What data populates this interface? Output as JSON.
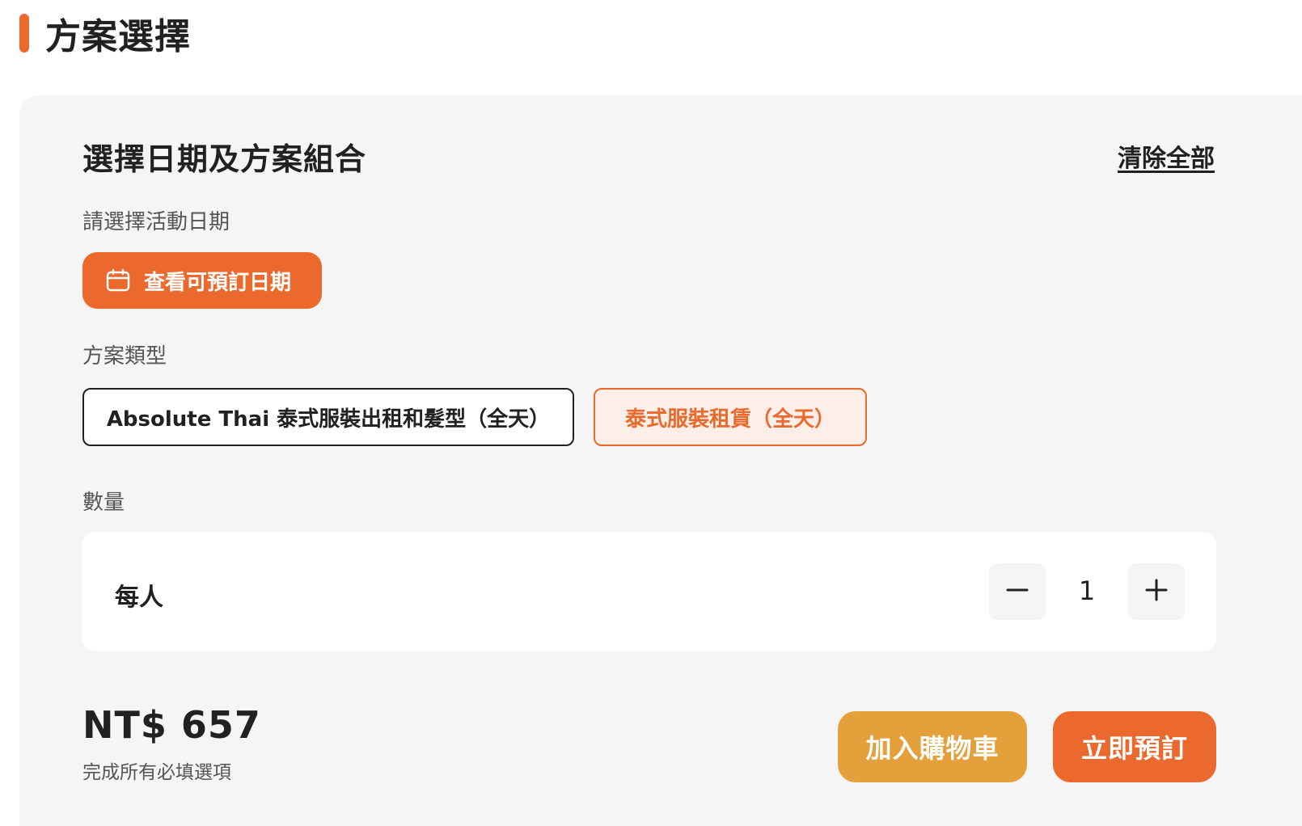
{
  "section": {
    "title": "方案選擇"
  },
  "panel": {
    "title": "選擇日期及方案組合",
    "clear_all": "清除全部"
  },
  "date": {
    "label": "請選擇活動日期",
    "button_label": "查看可預訂日期",
    "button_icon": "calendar-icon"
  },
  "package_type": {
    "label": "方案類型",
    "options": [
      {
        "label": "Absolute Thai 泰式服裝出租和髮型（全天）",
        "selected": false
      },
      {
        "label": "泰式服裝租賃（全天）",
        "selected": true
      }
    ]
  },
  "quantity": {
    "label": "數量",
    "item_label": "每人",
    "value": "1",
    "minus_icon": "minus-icon",
    "plus_icon": "plus-icon"
  },
  "footer": {
    "price": "NT$ 657",
    "hint": "完成所有必填選項",
    "add_to_cart": "加入購物車",
    "book_now": "立即預訂"
  },
  "colors": {
    "accent": "#eb692d",
    "cart": "#e4a03a",
    "selected_bg": "#fdefe7",
    "panel_bg": "#f5f5f5",
    "text": "#212121",
    "muted": "#555555"
  }
}
